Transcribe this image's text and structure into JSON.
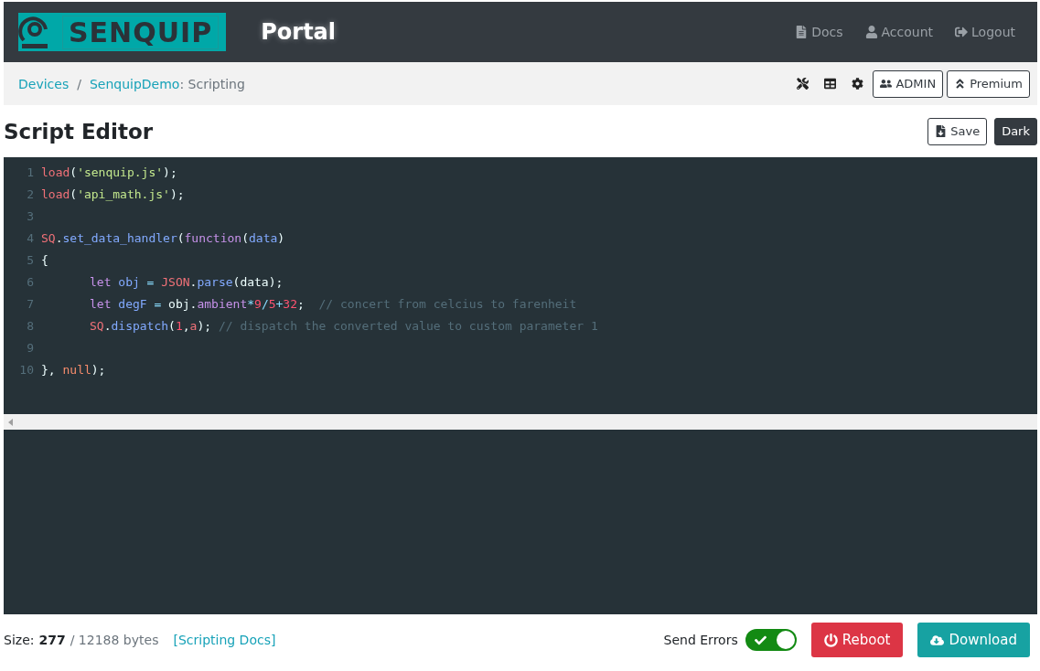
{
  "header": {
    "logo_text": "SENQUIP",
    "title": "Portal",
    "nav": [
      {
        "kind": "docs",
        "label": "Docs"
      },
      {
        "kind": "account",
        "label": "Account"
      },
      {
        "kind": "logout",
        "label": "Logout"
      }
    ]
  },
  "breadcrumb": {
    "items": [
      "Devices",
      "SenquipDemo"
    ],
    "separator": "/",
    "current": ": Scripting"
  },
  "toolbar": {
    "buttons": [
      {
        "kind": "admin",
        "label": "ADMIN"
      },
      {
        "kind": "premium",
        "label": "Premium"
      }
    ]
  },
  "page_title": "Script Editor",
  "actions": [
    {
      "kind": "save",
      "label": "Save"
    },
    {
      "kind": "dark",
      "label": "Dark"
    }
  ],
  "editor": {
    "lines": [
      {
        "number": "1",
        "indented": false,
        "tokens": [
          {
            "kind": "fn",
            "text": "load"
          },
          {
            "kind": "punct",
            "text": "("
          },
          {
            "kind": "str",
            "text": "'senquip.js'"
          },
          {
            "kind": "punct",
            "text": ");"
          }
        ]
      },
      {
        "number": "2",
        "indented": false,
        "tokens": [
          {
            "kind": "fn",
            "text": "load"
          },
          {
            "kind": "punct",
            "text": "("
          },
          {
            "kind": "str",
            "text": "'api_math.js'"
          },
          {
            "kind": "punct",
            "text": ");"
          }
        ]
      },
      {
        "number": "3"
      },
      {
        "number": "4",
        "indented": false,
        "tokens": [
          {
            "kind": "fn",
            "text": "SQ"
          },
          {
            "kind": "punct",
            "text": "."
          },
          {
            "kind": "var",
            "text": "set_data_handler"
          },
          {
            "kind": "punct",
            "text": "("
          },
          {
            "kind": "kw",
            "text": "function"
          },
          {
            "kind": "punct",
            "text": "("
          },
          {
            "kind": "var",
            "text": "data"
          },
          {
            "kind": "punct",
            "text": ")"
          }
        ]
      },
      {
        "number": "5",
        "indented": false,
        "tokens": [
          {
            "kind": "punct",
            "text": "{"
          }
        ]
      },
      {
        "number": "6",
        "indented": true,
        "tokens": [
          {
            "kind": "kw",
            "text": "let "
          },
          {
            "kind": "var",
            "text": "obj"
          },
          {
            "kind": "op",
            "text": " = "
          },
          {
            "kind": "fn",
            "text": "JSON"
          },
          {
            "kind": "punct",
            "text": "."
          },
          {
            "kind": "var",
            "text": "parse"
          },
          {
            "kind": "punct",
            "text": "(data);"
          }
        ]
      },
      {
        "number": "7",
        "indented": true,
        "tokens": [
          {
            "kind": "kw",
            "text": "let "
          },
          {
            "kind": "var",
            "text": "degF"
          },
          {
            "kind": "op",
            "text": " = "
          },
          {
            "kind": "punct",
            "text": "obj."
          },
          {
            "kind": "kw",
            "text": "ambient"
          },
          {
            "kind": "op",
            "text": "*"
          },
          {
            "kind": "num",
            "text": "9"
          },
          {
            "kind": "op",
            "text": "/"
          },
          {
            "kind": "num",
            "text": "5"
          },
          {
            "kind": "op",
            "text": "+"
          },
          {
            "kind": "num",
            "text": "32"
          },
          {
            "kind": "punct",
            "text": ";  "
          },
          {
            "kind": "comment",
            "text": "// concert from celcius to farenheit"
          }
        ]
      },
      {
        "number": "8",
        "indented": true,
        "tokens": [
          {
            "kind": "fn",
            "text": "SQ"
          },
          {
            "kind": "punct",
            "text": "."
          },
          {
            "kind": "var",
            "text": "dispatch"
          },
          {
            "kind": "punct",
            "text": "("
          },
          {
            "kind": "num",
            "text": "1"
          },
          {
            "kind": "punct",
            "text": ","
          },
          {
            "kind": "fn",
            "text": "a"
          },
          {
            "kind": "punct",
            "text": "); "
          },
          {
            "kind": "comment",
            "text": "// dispatch the converted value to custom parameter 1"
          }
        ]
      },
      {
        "number": "9"
      },
      {
        "number": "10",
        "indented": false,
        "tokens": [
          {
            "kind": "punct",
            "text": "}, "
          },
          {
            "kind": "num2",
            "text": "null"
          },
          {
            "kind": "punct",
            "text": ");"
          }
        ]
      }
    ]
  },
  "footer": {
    "size_label": "Size:",
    "size_value": "277",
    "size_total": "/ 12188 bytes",
    "docs_link": "[Scripting Docs]",
    "send_errors": {
      "label": "Send Errors",
      "on": true
    },
    "buttons": [
      {
        "kind": "reboot",
        "label": "Reboot"
      },
      {
        "kind": "download",
        "label": "Download"
      }
    ]
  }
}
